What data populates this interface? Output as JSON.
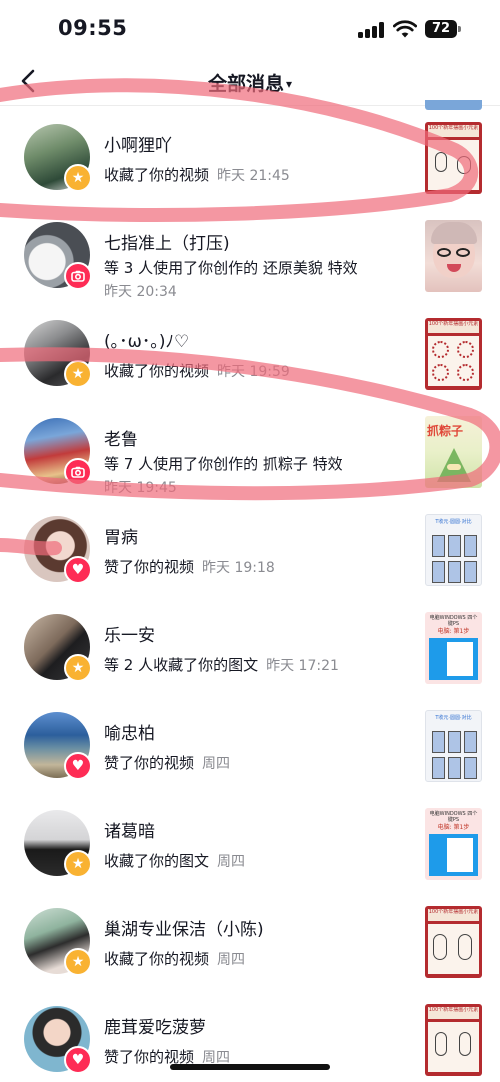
{
  "status_bar": {
    "time": "09:55",
    "battery": "72"
  },
  "header": {
    "title": "全部消息",
    "caret": "▾"
  },
  "messages": [
    {
      "name": "小啊狸吖",
      "action": "收藏了你的视频",
      "time": "昨天 21:45",
      "badge": "star-icon",
      "layout": "single"
    },
    {
      "name": "七指准上（打压)",
      "action": "等 3 人使用了你创作的 还原美貌 特效",
      "time": "昨天 20:34",
      "badge": "camera-icon",
      "layout": "double"
    },
    {
      "name": "(｡･ω･｡)ﾉ♡",
      "action": "收藏了你的视频",
      "time": "昨天 19:59",
      "badge": "star-icon",
      "layout": "single"
    },
    {
      "name": "老鲁",
      "action": "等 7 人使用了你创作的 抓粽子 特效",
      "time": "昨天 19:45",
      "badge": "camera-icon",
      "layout": "double"
    },
    {
      "name": "胃病",
      "action": "赞了你的视频",
      "time": "昨天 19:18",
      "badge": "heart-icon",
      "layout": "single"
    },
    {
      "name": "乐一安",
      "action": "等 2 人收藏了你的图文",
      "time": "昨天 17:21",
      "badge": "star-icon",
      "layout": "single"
    },
    {
      "name": "喻忠柏",
      "action": "赞了你的视频",
      "time": "周四",
      "badge": "heart-icon",
      "layout": "single"
    },
    {
      "name": "诸葛暗",
      "action": "收藏了你的图文",
      "time": "周四",
      "badge": "star-icon",
      "layout": "single"
    },
    {
      "name": "巢湖专业保洁（小陈)",
      "action": "收藏了你的视频",
      "time": "周四",
      "badge": "star-icon",
      "layout": "single"
    },
    {
      "name": "鹿茸爱吃菠萝",
      "action": "赞了你的视频",
      "time": "周四",
      "badge": "heart-icon",
      "layout": "single"
    }
  ],
  "thumbnails": [
    {
      "caption": "100个新年摆画小元素",
      "sub": "96. 跳舞"
    },
    {
      "caption": "",
      "sub": ""
    },
    {
      "caption": "100个新年摆画小元素",
      "sub": "97. 九连环"
    },
    {
      "caption": "抓粽子",
      "sub": ""
    },
    {
      "caption": "T收元·圆圆·对比",
      "sub": ""
    },
    {
      "caption": "电脑WINDOWS 四个键PS",
      "sub": "电脑: 第1步"
    },
    {
      "caption": "T收元·圆圆·对比",
      "sub": ""
    },
    {
      "caption": "电脑WINDOWS 四个键PS",
      "sub": "电脑: 第1步"
    },
    {
      "caption": "100个新年摆画小元素",
      "sub": "97. 打腰鼓"
    },
    {
      "caption": "100个新年摆画小元素",
      "sub": "99. 跳舞"
    }
  ],
  "colors": {
    "star": "#f9b232",
    "heart": "#fe2c55",
    "scribble": "#f06b7a"
  }
}
